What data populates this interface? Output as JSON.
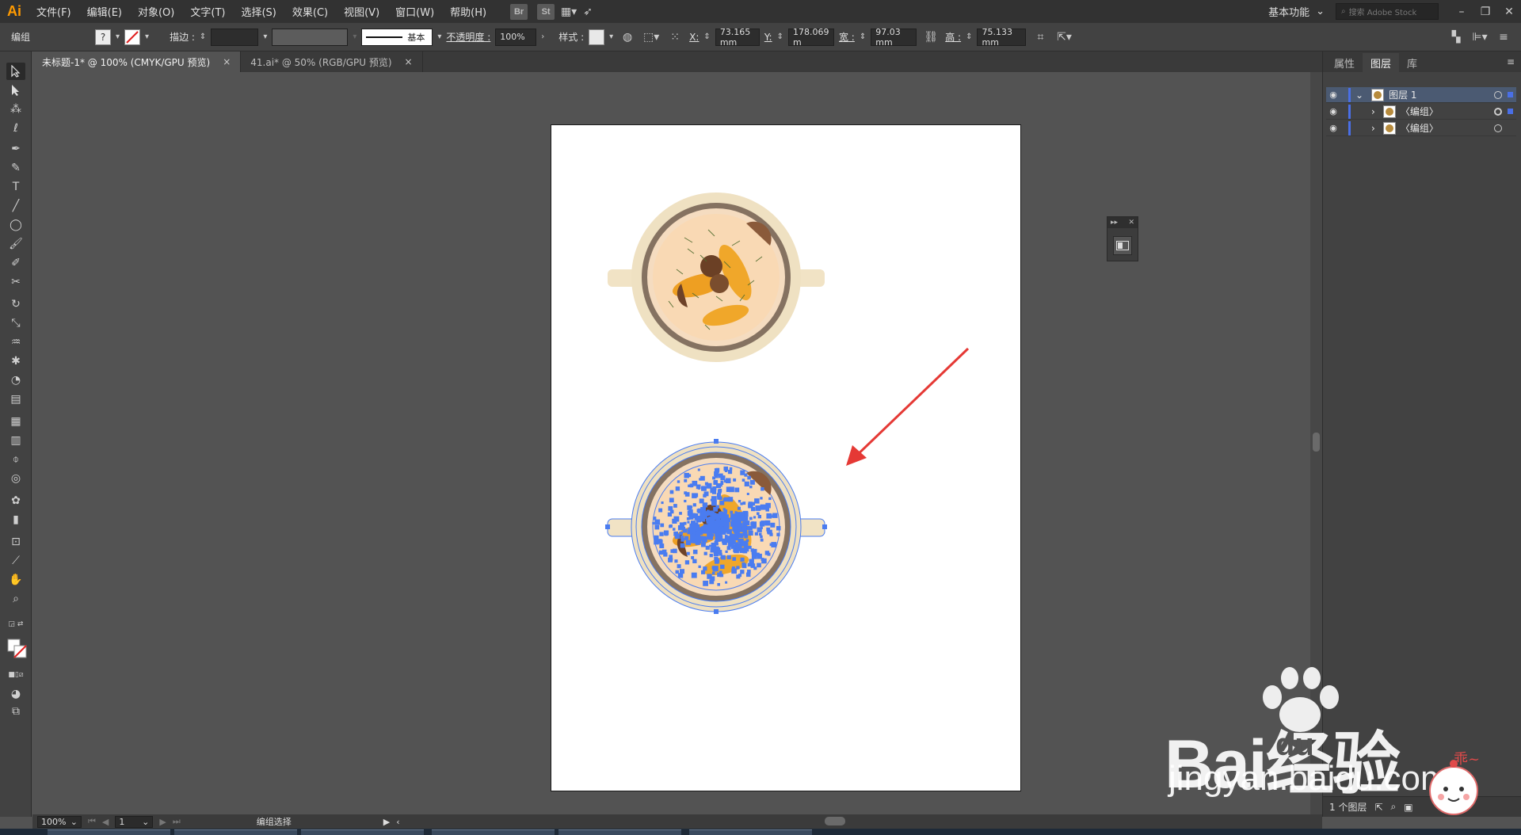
{
  "app": {
    "logo": "Ai"
  },
  "menu": {
    "items": [
      "文件(F)",
      "编辑(E)",
      "对象(O)",
      "文字(T)",
      "选择(S)",
      "效果(C)",
      "视图(V)",
      "窗口(W)",
      "帮助(H)"
    ],
    "bridge": "Br",
    "stock": "St",
    "workspace": "基本功能",
    "search_placeholder": "搜索 Adobe Stock"
  },
  "control": {
    "selection_type": "编组",
    "stroke_label": "描边 :",
    "stroke_profile": "基本",
    "opacity_label": "不透明度 :",
    "opacity_value": "100%",
    "style_label": "样式 :",
    "x_label": "X:",
    "x_value": "73.165 mm",
    "y_label": "Y:",
    "y_value": "178.069 m",
    "w_label": "宽 :",
    "w_value": "97.03 mm",
    "h_label": "高 :",
    "h_value": "75.133 mm",
    "fill_unknown": "?"
  },
  "tabs": [
    {
      "label": "未标题-1* @ 100% (CMYK/GPU 预览)",
      "close": "×"
    },
    {
      "label": "41.ai* @ 50% (RGB/GPU 预览)",
      "close": "×"
    }
  ],
  "panel": {
    "tabs": [
      "属性",
      "图层",
      "库"
    ],
    "layers": [
      {
        "name": "图层 1"
      },
      {
        "name": "〈编组〉"
      },
      {
        "name": "〈编组〉"
      }
    ],
    "footer_count": "1 个图层"
  },
  "status": {
    "zoom": "100%",
    "artboard_num": "1",
    "tool_hint": "编组选择"
  },
  "watermark": {
    "brand": "Bai经验",
    "brand_du": "du",
    "url": "jingyan.baidu.com",
    "sticker_text": "乖~"
  },
  "colors": {
    "accent": "#4a6fe6",
    "arrow": "#e53935",
    "selection": "#4a7cf0"
  }
}
